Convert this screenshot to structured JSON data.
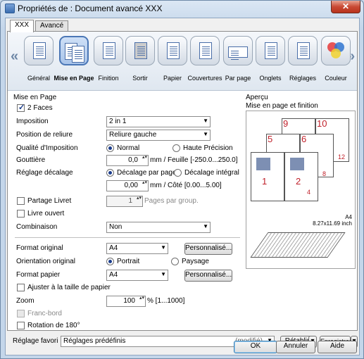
{
  "window": {
    "title": "Propriétés de : Document avancé XXX",
    "close": "✕"
  },
  "tabs": [
    "XXX",
    "Avancé"
  ],
  "ribbon": {
    "left_arrow": "«",
    "right_arrow": "»",
    "items": [
      "Général",
      "Mise en Page",
      "Finition",
      "Sortir",
      "Papier",
      "Couvertures",
      "Par page",
      "Onglets",
      "Réglages",
      "Couleur"
    ]
  },
  "layout": {
    "section_title": "Mise en Page",
    "two_faces": "2 Faces",
    "imposition_label": "Imposition",
    "imposition_value": "2 in 1",
    "binding_label": "Position de reliure",
    "binding_value": "Reliure gauche",
    "quality_label": "Qualité d'Imposition",
    "quality_normal": "Normal",
    "quality_high": "Haute Précision",
    "gutter_label": "Gouttière",
    "gutter_value": "0,0",
    "gutter_unit": "mm / Feuille [-250.0...250.0]",
    "shift_label": "Réglage décalage",
    "shift_per_page": "Décalage par page",
    "shift_integral": "Décalage intégral",
    "shift_value": "0,00",
    "shift_unit": "mm / Côté [0.00...5.00]",
    "booklet_label": "Partage Livret",
    "booklet_value": "1",
    "booklet_unit": "Pages par group.",
    "open_book": "Livre ouvert",
    "combination_label": "Combinaison",
    "combination_value": "Non",
    "original_format_label": "Format original",
    "original_format_value": "A4",
    "custom_button": "Personnalisé...",
    "orientation_label": "Orientation original",
    "portrait": "Portrait",
    "landscape": "Paysage",
    "paper_format_label": "Format papier",
    "paper_format_value": "A4",
    "fit_label": "Ajuster à la taille de papier",
    "zoom_label": "Zoom",
    "zoom_value": "100",
    "zoom_unit": "% [1...1000]",
    "borderless": "Franc-bord",
    "rotate": "Rotation de 180°"
  },
  "preview": {
    "section_title": "Aperçu",
    "subtitle": "Mise en page et finition",
    "pages": [
      "1",
      "2",
      "5",
      "6",
      "9",
      "10",
      "4",
      "8",
      "12"
    ],
    "paper_size": "A4",
    "paper_dims": "8.27x11.69 inch"
  },
  "favorites": {
    "label": "Réglage favori",
    "value": "Réglages prédéfinis",
    "status": "(modifié)",
    "restore": "Rétablir",
    "save": "Enregistrer"
  },
  "footer": {
    "ok": "OK",
    "cancel": "Annuler",
    "help": "Aide"
  }
}
